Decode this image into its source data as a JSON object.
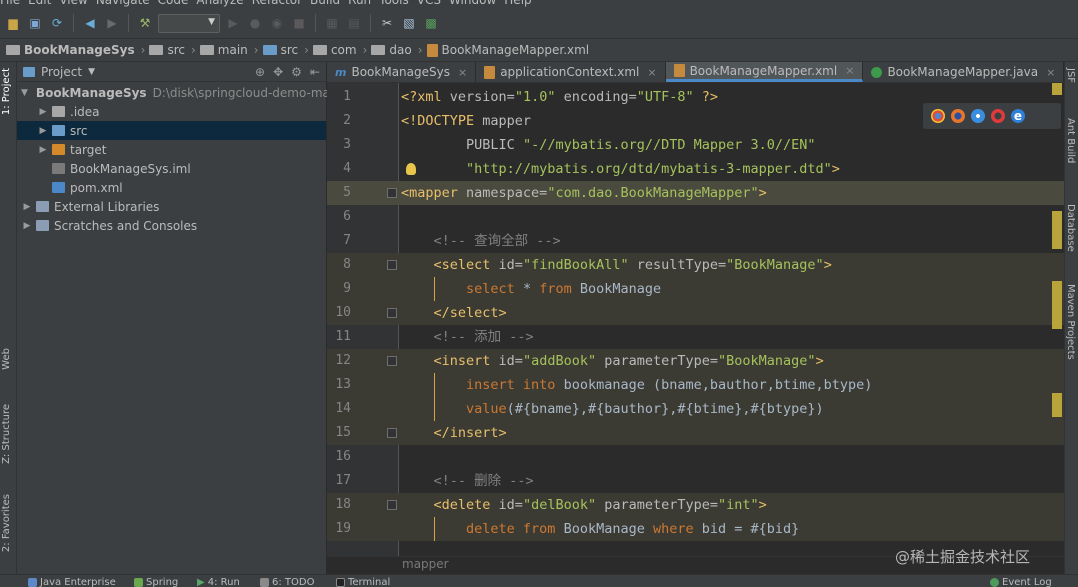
{
  "menu": [
    "File",
    "Edit",
    "View",
    "Navigate",
    "Code",
    "Analyze",
    "Refactor",
    "Build",
    "Run",
    "Tools",
    "VCS",
    "Window",
    "Help"
  ],
  "breadcrumb": [
    "BookManageSys",
    "src",
    "main",
    "src",
    "com",
    "dao",
    "BookManageMapper.xml"
  ],
  "project_panel": {
    "title": "Project",
    "tree": [
      {
        "label": "BookManageSys",
        "path": "D:\\disk\\springcloud-demo-master\\",
        "indent": 0,
        "arrow": "▼",
        "icon": "folder",
        "bold": true
      },
      {
        "label": ".idea",
        "indent": 1,
        "arrow": "▶",
        "icon": "folder"
      },
      {
        "label": "src",
        "indent": 1,
        "arrow": "▶",
        "icon": "folder-blue",
        "selected": true
      },
      {
        "label": "target",
        "indent": 1,
        "arrow": "▶",
        "icon": "folder-orange"
      },
      {
        "label": "BookManageSys.iml",
        "indent": 1,
        "arrow": "",
        "icon": "iml-file"
      },
      {
        "label": "pom.xml",
        "indent": 1,
        "arrow": "",
        "icon": "maven-file"
      },
      {
        "label": "External Libraries",
        "indent": 0,
        "arrow": "▶",
        "icon": "library"
      },
      {
        "label": "Scratches and Consoles",
        "indent": 0,
        "arrow": "▶",
        "icon": "scratches"
      }
    ]
  },
  "editor_tabs": [
    {
      "label": "BookManageSys",
      "icon": "m"
    },
    {
      "label": "applicationContext.xml",
      "icon": "xml"
    },
    {
      "label": "BookManageMapper.xml",
      "icon": "xml",
      "active": true
    },
    {
      "label": "BookManageMapper.java",
      "icon": "java"
    }
  ],
  "code_lines": [
    {
      "n": "1",
      "html": "<span class='tag'>&lt;?xml </span><span class='attr'>version=</span><span class='str'>\"1.0\"</span><span class='attr'> encoding=</span><span class='str'>\"UTF-8\"</span><span class='tag'> ?&gt;</span>"
    },
    {
      "n": "2",
      "html": "<span class='doctype'>&lt;!DOCTYPE </span><span class='attr'>mapper</span>"
    },
    {
      "n": "3",
      "html": "        <span class='attr'>PUBLIC </span><span class='str'>\"-//mybatis.org//DTD Mapper 3.0//EN\"</span>"
    },
    {
      "n": "4",
      "html": "        <span class='str'>\"http://mybatis.org/dtd/mybatis-3-mapper.dtd\"</span><span class='doctype'>&gt;</span>"
    },
    {
      "n": "5",
      "html": "<span class='tag'>&lt;mapper </span><span class='attr'>namespace=</span><span class='str'>\"com.dao.BookManageMapper\"</span><span class='tag'>&gt;</span>"
    },
    {
      "n": "6",
      "html": ""
    },
    {
      "n": "7",
      "html": "    <span class='com'>&lt;!-- 查询全部 --&gt;</span>"
    },
    {
      "n": "8",
      "html": "    <span class='tag'>&lt;select </span><span class='attr'>id=</span><span class='str'>\"findBookAll\"</span><span class='attr'> resultType=</span><span class='str'>\"BookManage\"</span><span class='tag'>&gt;</span>"
    },
    {
      "n": "9",
      "html": "        <span class='kw'>select</span> * <span class='kw'>from</span> BookManage"
    },
    {
      "n": "10",
      "html": "    <span class='tag'>&lt;/select&gt;</span>"
    },
    {
      "n": "11",
      "html": "    <span class='com'>&lt;!-- 添加 --&gt;</span>"
    },
    {
      "n": "12",
      "html": "    <span class='tag'>&lt;insert </span><span class='attr'>id=</span><span class='str'>\"addBook\"</span><span class='attr'> parameterType=</span><span class='str'>\"BookManage\"</span><span class='tag'>&gt;</span>"
    },
    {
      "n": "13",
      "html": "        <span class='kw'>insert into</span> bookmanage (bname,bauthor,btime,btype)"
    },
    {
      "n": "14",
      "html": "        <span class='kw'>value</span>(#{bname},#{bauthor},#{btime},#{btype})"
    },
    {
      "n": "15",
      "html": "    <span class='tag'>&lt;/insert&gt;</span>"
    },
    {
      "n": "16",
      "html": ""
    },
    {
      "n": "17",
      "html": "    <span class='com'>&lt;!-- 删除 --&gt;</span>"
    },
    {
      "n": "18",
      "html": "    <span class='tag'>&lt;delete </span><span class='attr'>id=</span><span class='str'>\"delBook\"</span><span class='attr'> parameterType=</span><span class='str'>\"int\"</span><span class='tag'>&gt;</span>"
    },
    {
      "n": "19",
      "html": "        <span class='kw'>delete from</span> BookManage <span class='kw'>where</span> bid = #{bid}"
    }
  ],
  "editor_footer": "mapper",
  "left_tool_tabs": [
    "1: Project",
    "Web",
    "Z: Structure",
    "2: Favorites"
  ],
  "right_tool_tabs": [
    "JSF",
    "Ant Build",
    "Database",
    "Maven Projects"
  ],
  "bottom_tools": [
    "Java Enterprise",
    "Spring",
    "4: Run",
    "6: TODO",
    "Terminal",
    "Event Log"
  ],
  "watermark": "@稀土掘金技术社区",
  "colors": {
    "accent": "#4a88c7",
    "selection": "#0d293e",
    "tag": "#e8bf6a",
    "string": "#a5c25c",
    "keyword": "#cc7832"
  }
}
